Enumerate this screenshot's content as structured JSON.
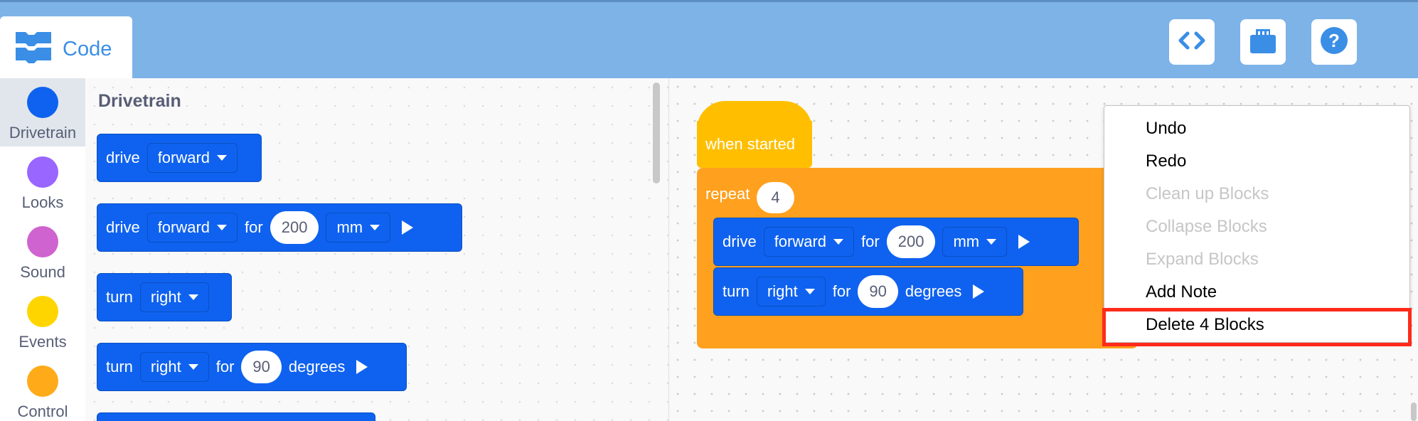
{
  "header": {
    "tab_label": "Code",
    "buttons": [
      {
        "name": "code-view",
        "icon": "code-brackets-icon"
      },
      {
        "name": "device",
        "icon": "brain-device-icon"
      },
      {
        "name": "help",
        "icon": "help-icon"
      }
    ]
  },
  "categories": [
    {
      "label": "Drivetrain",
      "color": "#0f62ef",
      "active": true
    },
    {
      "label": "Looks",
      "color": "#9966ff",
      "active": false
    },
    {
      "label": "Sound",
      "color": "#cf63cf",
      "active": false
    },
    {
      "label": "Events",
      "color": "#ffd500",
      "active": false
    },
    {
      "label": "Control",
      "color": "#ffab19",
      "active": false
    }
  ],
  "flyout": {
    "title": "Drivetrain",
    "blocks": {
      "drive_simple": {
        "verb": "drive",
        "dir": "forward"
      },
      "drive_for": {
        "verb": "drive",
        "dir": "forward",
        "for": "for",
        "amount": "200",
        "unit": "mm"
      },
      "turn_simple": {
        "verb": "turn",
        "dir": "right"
      },
      "turn_for": {
        "verb": "turn",
        "dir": "right",
        "for": "for",
        "amount": "90",
        "unit": "degrees"
      }
    }
  },
  "workspace": {
    "hat": {
      "label": "when started"
    },
    "repeat": {
      "label": "repeat",
      "count": "4"
    },
    "drive": {
      "verb": "drive",
      "dir": "forward",
      "for": "for",
      "amount": "200",
      "unit": "mm"
    },
    "turn": {
      "verb": "turn",
      "dir": "right",
      "for": "for",
      "amount": "90",
      "unit": "degrees"
    }
  },
  "context_menu": {
    "items": [
      {
        "label": "Undo",
        "enabled": true
      },
      {
        "label": "Redo",
        "enabled": true
      },
      {
        "label": "Clean up Blocks",
        "enabled": false
      },
      {
        "label": "Collapse Blocks",
        "enabled": false
      },
      {
        "label": "Expand Blocks",
        "enabled": false
      },
      {
        "label": "Add Note",
        "enabled": true
      },
      {
        "label": "Delete 4 Blocks",
        "enabled": true
      }
    ],
    "highlighted": "Delete 4 Blocks"
  },
  "colors": {
    "header": "#7eb3e8",
    "block_blue": "#0f62ef",
    "block_orange": "#ffa01e",
    "block_yellow": "#ffbf00",
    "highlight": "#ff2a1a"
  }
}
